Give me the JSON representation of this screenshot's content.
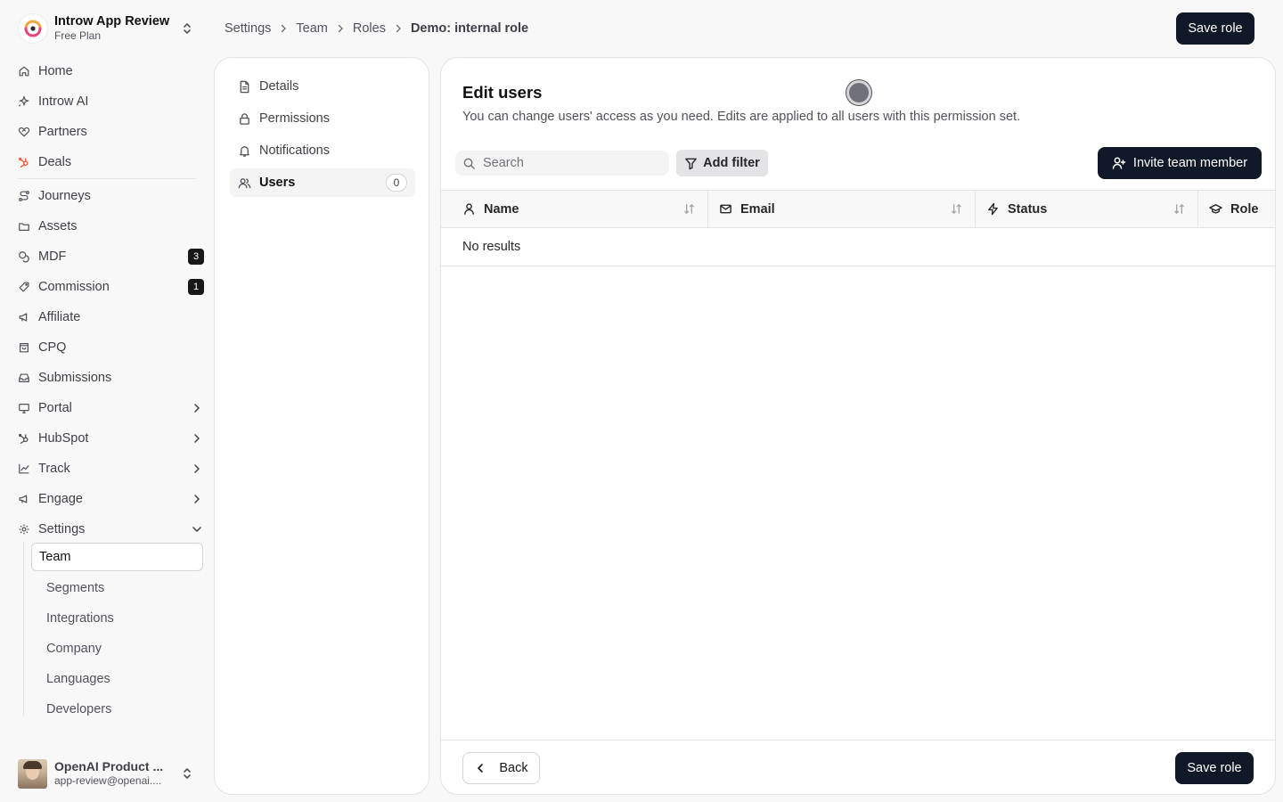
{
  "org": {
    "name": "Introw App Review",
    "plan": "Free Plan"
  },
  "nav": {
    "items": [
      {
        "label": "Home",
        "icon": "home-icon"
      },
      {
        "label": "Introw AI",
        "icon": "sparkle-icon"
      },
      {
        "label": "Partners",
        "icon": "handshake-icon"
      },
      {
        "label": "Deals",
        "icon": "hubspot-icon"
      },
      {
        "label": "Journeys",
        "icon": "route-icon"
      },
      {
        "label": "Assets",
        "icon": "folder-icon"
      },
      {
        "label": "MDF",
        "icon": "coins-icon",
        "badge": "3"
      },
      {
        "label": "Commission",
        "icon": "tag-icon",
        "badge": "1"
      },
      {
        "label": "Affiliate",
        "icon": "megaphone-icon"
      },
      {
        "label": "CPQ",
        "icon": "shopping-bag-icon"
      },
      {
        "label": "Submissions",
        "icon": "inbox-icon"
      },
      {
        "label": "Portal",
        "icon": "monitor-icon"
      },
      {
        "label": "HubSpot",
        "icon": "hubspot-icon"
      },
      {
        "label": "Track",
        "icon": "chart-line-icon"
      },
      {
        "label": "Engage",
        "icon": "megaphone-icon"
      },
      {
        "label": "Settings",
        "icon": "gear-icon"
      }
    ],
    "settings_sub": [
      "Team",
      "Segments",
      "Integrations",
      "Company",
      "Languages",
      "Developers"
    ]
  },
  "user": {
    "name": "OpenAI Product ...",
    "email": "app-review@openai...."
  },
  "breadcrumb": {
    "items": [
      "Settings",
      "Team",
      "Roles"
    ],
    "current": "Demo: internal role"
  },
  "save_label": "Save role",
  "side_menu": {
    "items": [
      {
        "label": "Details",
        "icon": "document-icon"
      },
      {
        "label": "Permissions",
        "icon": "lock-icon"
      },
      {
        "label": "Notifications",
        "icon": "bell-icon"
      },
      {
        "label": "Users",
        "icon": "users-icon",
        "count": "0"
      }
    ]
  },
  "main": {
    "title": "Edit users",
    "description": "You can change users' access as you need. Edits are applied to all users with this permission set.",
    "search_placeholder": "Search",
    "filter_label": "Add filter",
    "invite_label": "Invite team member",
    "columns": [
      "Name",
      "Email",
      "Status",
      "Role"
    ],
    "empty_text": "No results",
    "back_label": "Back"
  }
}
